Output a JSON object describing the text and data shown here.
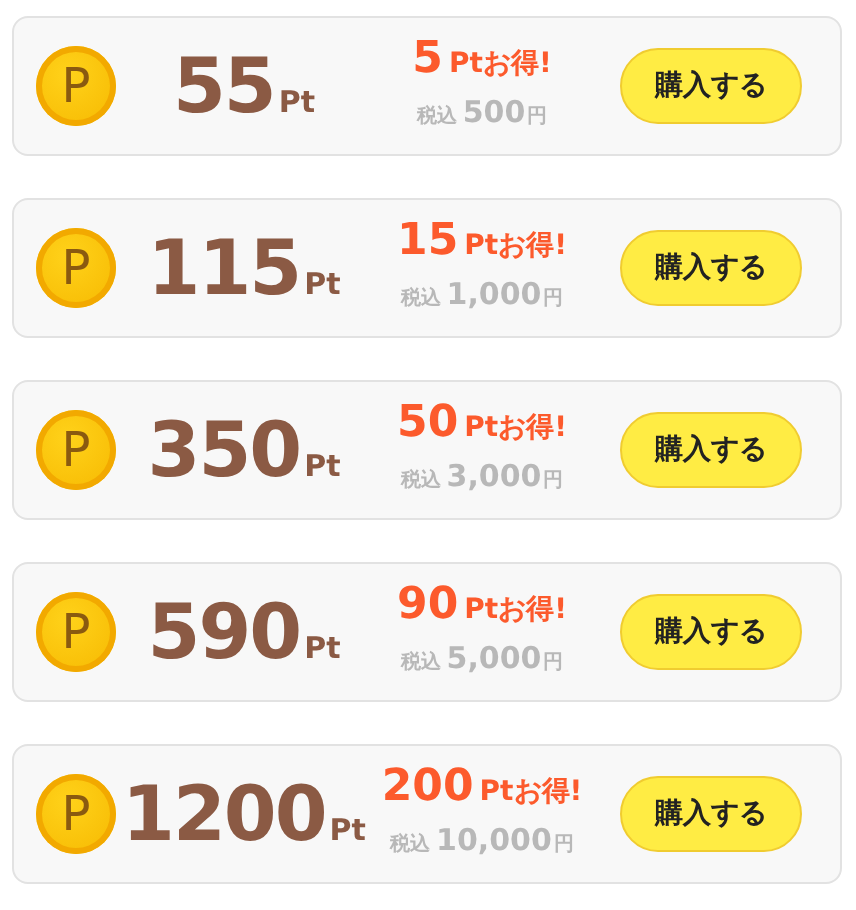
{
  "packages": [
    {
      "coin": "P",
      "points": "55",
      "points_unit": "Pt",
      "bonus": "5",
      "bonus_label": "Ptお得!",
      "tax_label": "税込",
      "price": "500",
      "currency": "円",
      "button": "購入する"
    },
    {
      "coin": "P",
      "points": "115",
      "points_unit": "Pt",
      "bonus": "15",
      "bonus_label": "Ptお得!",
      "tax_label": "税込",
      "price": "1,000",
      "currency": "円",
      "button": "購入する"
    },
    {
      "coin": "P",
      "points": "350",
      "points_unit": "Pt",
      "bonus": "50",
      "bonus_label": "Ptお得!",
      "tax_label": "税込",
      "price": "3,000",
      "currency": "円",
      "button": "購入する"
    },
    {
      "coin": "P",
      "points": "590",
      "points_unit": "Pt",
      "bonus": "90",
      "bonus_label": "Ptお得!",
      "tax_label": "税込",
      "price": "5,000",
      "currency": "円",
      "button": "購入する"
    },
    {
      "coin": "P",
      "points": "1200",
      "points_unit": "Pt",
      "bonus": "200",
      "bonus_label": "Ptお得!",
      "tax_label": "税込",
      "price": "10,000",
      "currency": "円",
      "button": "購入する"
    }
  ]
}
